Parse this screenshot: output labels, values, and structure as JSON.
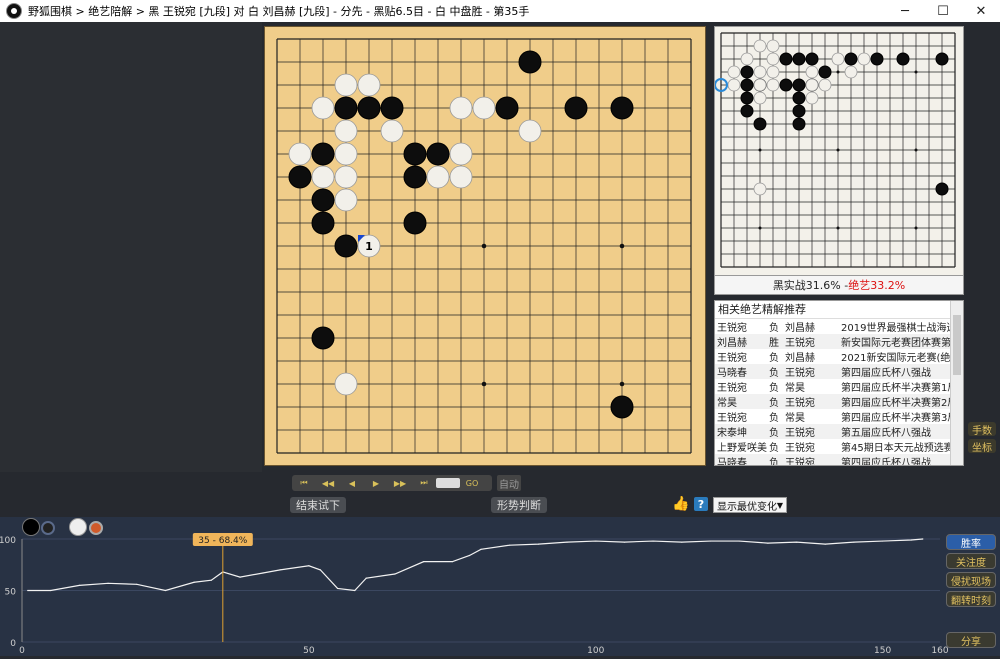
{
  "window": {
    "title": "野狐围棋 > 绝艺陪解 > 黑 王锐宛 [九段] 对 白 刘昌赫 [九段] - 分先 - 黑贴6.5目 - 白 中盘胜 - 第35手"
  },
  "main_board": {
    "black": [
      [
        11,
        1
      ],
      [
        3,
        3
      ],
      [
        4,
        3
      ],
      [
        5,
        3
      ],
      [
        10,
        3
      ],
      [
        13,
        3
      ],
      [
        15,
        3
      ],
      [
        2,
        5
      ],
      [
        6,
        5
      ],
      [
        7,
        5
      ],
      [
        1,
        6
      ],
      [
        6,
        6
      ],
      [
        2,
        7
      ],
      [
        2,
        8
      ],
      [
        6,
        8
      ],
      [
        3,
        9
      ],
      [
        2,
        13
      ],
      [
        15,
        16
      ]
    ],
    "white": [
      [
        3,
        2
      ],
      [
        4,
        2
      ],
      [
        2,
        3
      ],
      [
        8,
        3
      ],
      [
        9,
        3
      ],
      [
        11,
        4
      ],
      [
        3,
        4
      ],
      [
        5,
        4
      ],
      [
        1,
        5
      ],
      [
        3,
        5
      ],
      [
        8,
        5
      ],
      [
        2,
        6
      ],
      [
        3,
        6
      ],
      [
        7,
        6
      ],
      [
        8,
        6
      ],
      [
        3,
        7
      ],
      [
        4,
        9
      ],
      [
        3,
        15
      ]
    ],
    "last_move": {
      "col": 4,
      "row": 9,
      "label": "1"
    },
    "star_points": [
      [
        3,
        3
      ],
      [
        9,
        3
      ],
      [
        15,
        3
      ],
      [
        3,
        9
      ],
      [
        9,
        9
      ],
      [
        15,
        9
      ],
      [
        3,
        15
      ],
      [
        9,
        15
      ],
      [
        15,
        15
      ]
    ]
  },
  "mini_board": {
    "black": [
      [
        8,
        3
      ],
      [
        10,
        2
      ],
      [
        12,
        2
      ],
      [
        14,
        2
      ],
      [
        17,
        2
      ],
      [
        6,
        2
      ],
      [
        5,
        2
      ],
      [
        7,
        2
      ],
      [
        2,
        4
      ],
      [
        3,
        4
      ],
      [
        6,
        4
      ],
      [
        7,
        4
      ],
      [
        2,
        5
      ],
      [
        6,
        5
      ],
      [
        2,
        6
      ],
      [
        6,
        6
      ],
      [
        3,
        7
      ],
      [
        2,
        3
      ],
      [
        6,
        7
      ],
      [
        5,
        4
      ],
      [
        17,
        12
      ]
    ],
    "white": [
      [
        3,
        1
      ],
      [
        4,
        1
      ],
      [
        2,
        2
      ],
      [
        4,
        2
      ],
      [
        9,
        2
      ],
      [
        10,
        3
      ],
      [
        11,
        2
      ],
      [
        1,
        3
      ],
      [
        3,
        3
      ],
      [
        3,
        4
      ],
      [
        1,
        4
      ],
      [
        4,
        4
      ],
      [
        7,
        3
      ],
      [
        7,
        4
      ],
      [
        8,
        4
      ],
      [
        7,
        5
      ],
      [
        3,
        5
      ],
      [
        4,
        3
      ],
      [
        3,
        12
      ]
    ],
    "star_points": [
      [
        3,
        3
      ],
      [
        9,
        3
      ],
      [
        15,
        3
      ],
      [
        3,
        9
      ],
      [
        9,
        9
      ],
      [
        15,
        9
      ],
      [
        3,
        15
      ],
      [
        9,
        15
      ],
      [
        15,
        15
      ]
    ]
  },
  "mini_caption": {
    "left": "黑实战31.6% - ",
    "right": "绝艺33.2%"
  },
  "recommendations": {
    "header": "相关绝艺精解推荐",
    "rows": [
      [
        "王锐宛",
        "负",
        "刘昌赫",
        "2019世界最强棋士战海选半决"
      ],
      [
        "刘昌赫",
        "胜",
        "王锐宛",
        "新安国际元老赛团体赛第3轮"
      ],
      [
        "王锐宛",
        "负",
        "刘昌赫",
        "2021新安国际元老赛(绝"
      ],
      [
        "马晓春",
        "负",
        "王锐宛",
        "第四届应氏杯八强战"
      ],
      [
        "王锐宛",
        "负",
        "常昊",
        "第四届应氏杯半决赛第1局"
      ],
      [
        "常昊",
        "负",
        "王锐宛",
        "第四届应氏杯半决赛第2局"
      ],
      [
        "王锐宛",
        "负",
        "常昊",
        "第四届应氏杯半决赛第3局"
      ],
      [
        "宋泰坤",
        "负",
        "王锐宛",
        "第五届应氏杯八强战"
      ],
      [
        "上野爱咲美",
        "负",
        "王锐宛",
        "第45期日本天元战预选赛"
      ],
      [
        "马晓春",
        "负",
        "王锐宛",
        "第四届应氏杯八强战"
      ]
    ]
  },
  "side_buttons": {
    "moves": "手数",
    "coords": "坐标"
  },
  "nav": {
    "first": "⏮",
    "back5": "◀◀",
    "back": "◀",
    "fwd": "▶",
    "fwd5": "▶▶",
    "last": "⏭",
    "go": "GO",
    "auto": "自动"
  },
  "buttons": {
    "end_try": "结束试下",
    "judge": "形势判断"
  },
  "select": {
    "value": "显示最优变化"
  },
  "chart_data": {
    "type": "line",
    "title": "",
    "xlabel": "",
    "ylabel": "",
    "xlim": [
      0,
      160
    ],
    "ylim": [
      0,
      100
    ],
    "x_ticks": [
      0,
      50,
      100,
      150,
      160
    ],
    "y_ticks": [
      0,
      50,
      100
    ],
    "marker": {
      "x": 35,
      "label": "35 - 68.4%"
    },
    "series": [
      {
        "x": [
          1,
          5,
          10,
          15,
          20,
          25,
          30,
          33,
          35,
          38,
          42,
          45,
          50,
          52,
          55,
          58,
          60,
          65,
          70,
          75,
          78,
          80,
          85,
          90,
          95,
          100,
          105,
          110,
          115,
          120,
          125,
          130,
          135,
          140,
          145,
          150,
          155,
          157
        ],
        "y": [
          50,
          50,
          55,
          57,
          56,
          50,
          58,
          60,
          68,
          63,
          67,
          70,
          74,
          70,
          52,
          50,
          62,
          66,
          78,
          78,
          84,
          90,
          94,
          95,
          97,
          98,
          97,
          98,
          97,
          98,
          98,
          96,
          97,
          95,
          97,
          98,
          99,
          100
        ]
      }
    ]
  },
  "right_buttons": {
    "winrate": "胜率",
    "attention": "关注度",
    "bystanders": "侵扰现场",
    "key_moments": "翻转时刻",
    "share": "分享"
  }
}
